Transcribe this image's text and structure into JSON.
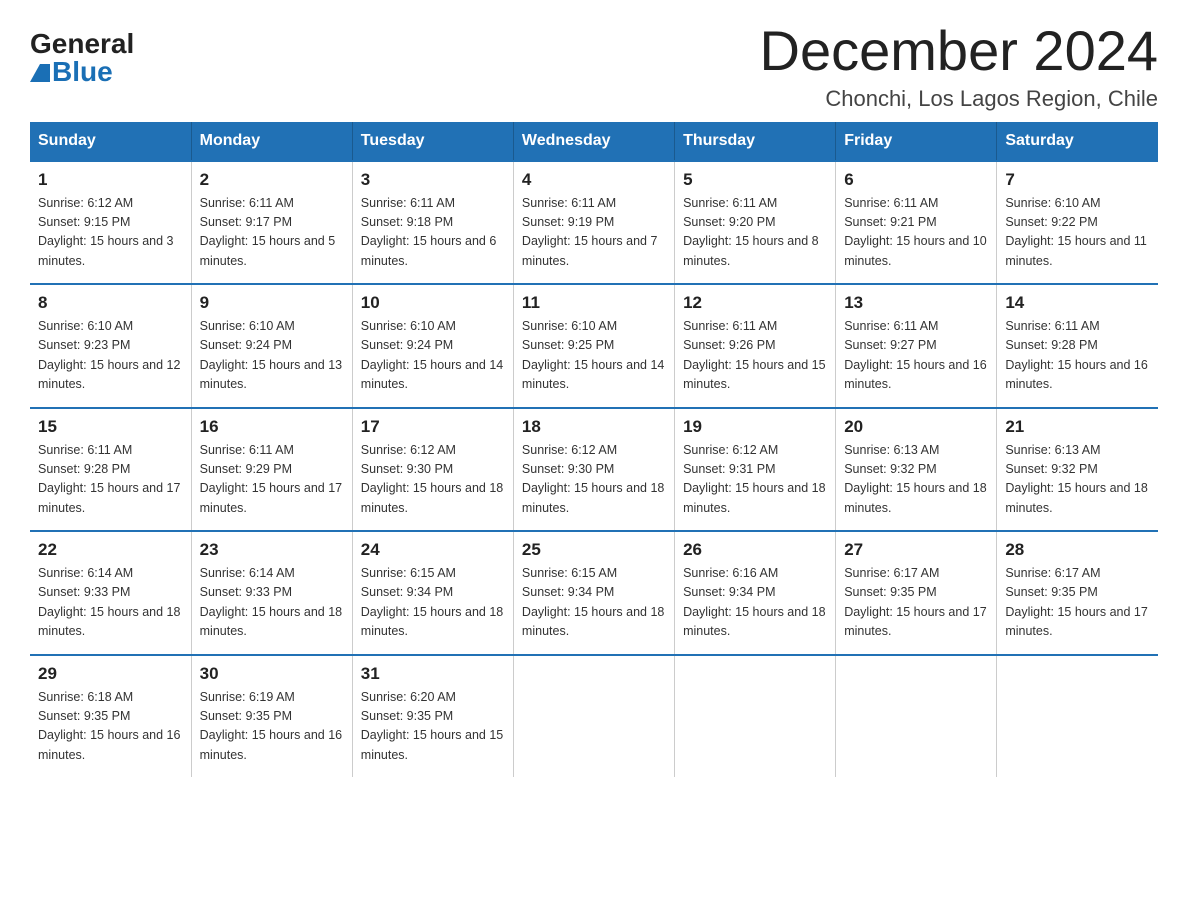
{
  "logo": {
    "general": "General",
    "blue": "Blue"
  },
  "title": "December 2024",
  "subtitle": "Chonchi, Los Lagos Region, Chile",
  "headers": [
    "Sunday",
    "Monday",
    "Tuesday",
    "Wednesday",
    "Thursday",
    "Friday",
    "Saturday"
  ],
  "weeks": [
    [
      {
        "day": "1",
        "sunrise": "Sunrise: 6:12 AM",
        "sunset": "Sunset: 9:15 PM",
        "daylight": "Daylight: 15 hours and 3 minutes."
      },
      {
        "day": "2",
        "sunrise": "Sunrise: 6:11 AM",
        "sunset": "Sunset: 9:17 PM",
        "daylight": "Daylight: 15 hours and 5 minutes."
      },
      {
        "day": "3",
        "sunrise": "Sunrise: 6:11 AM",
        "sunset": "Sunset: 9:18 PM",
        "daylight": "Daylight: 15 hours and 6 minutes."
      },
      {
        "day": "4",
        "sunrise": "Sunrise: 6:11 AM",
        "sunset": "Sunset: 9:19 PM",
        "daylight": "Daylight: 15 hours and 7 minutes."
      },
      {
        "day": "5",
        "sunrise": "Sunrise: 6:11 AM",
        "sunset": "Sunset: 9:20 PM",
        "daylight": "Daylight: 15 hours and 8 minutes."
      },
      {
        "day": "6",
        "sunrise": "Sunrise: 6:11 AM",
        "sunset": "Sunset: 9:21 PM",
        "daylight": "Daylight: 15 hours and 10 minutes."
      },
      {
        "day": "7",
        "sunrise": "Sunrise: 6:10 AM",
        "sunset": "Sunset: 9:22 PM",
        "daylight": "Daylight: 15 hours and 11 minutes."
      }
    ],
    [
      {
        "day": "8",
        "sunrise": "Sunrise: 6:10 AM",
        "sunset": "Sunset: 9:23 PM",
        "daylight": "Daylight: 15 hours and 12 minutes."
      },
      {
        "day": "9",
        "sunrise": "Sunrise: 6:10 AM",
        "sunset": "Sunset: 9:24 PM",
        "daylight": "Daylight: 15 hours and 13 minutes."
      },
      {
        "day": "10",
        "sunrise": "Sunrise: 6:10 AM",
        "sunset": "Sunset: 9:24 PM",
        "daylight": "Daylight: 15 hours and 14 minutes."
      },
      {
        "day": "11",
        "sunrise": "Sunrise: 6:10 AM",
        "sunset": "Sunset: 9:25 PM",
        "daylight": "Daylight: 15 hours and 14 minutes."
      },
      {
        "day": "12",
        "sunrise": "Sunrise: 6:11 AM",
        "sunset": "Sunset: 9:26 PM",
        "daylight": "Daylight: 15 hours and 15 minutes."
      },
      {
        "day": "13",
        "sunrise": "Sunrise: 6:11 AM",
        "sunset": "Sunset: 9:27 PM",
        "daylight": "Daylight: 15 hours and 16 minutes."
      },
      {
        "day": "14",
        "sunrise": "Sunrise: 6:11 AM",
        "sunset": "Sunset: 9:28 PM",
        "daylight": "Daylight: 15 hours and 16 minutes."
      }
    ],
    [
      {
        "day": "15",
        "sunrise": "Sunrise: 6:11 AM",
        "sunset": "Sunset: 9:28 PM",
        "daylight": "Daylight: 15 hours and 17 minutes."
      },
      {
        "day": "16",
        "sunrise": "Sunrise: 6:11 AM",
        "sunset": "Sunset: 9:29 PM",
        "daylight": "Daylight: 15 hours and 17 minutes."
      },
      {
        "day": "17",
        "sunrise": "Sunrise: 6:12 AM",
        "sunset": "Sunset: 9:30 PM",
        "daylight": "Daylight: 15 hours and 18 minutes."
      },
      {
        "day": "18",
        "sunrise": "Sunrise: 6:12 AM",
        "sunset": "Sunset: 9:30 PM",
        "daylight": "Daylight: 15 hours and 18 minutes."
      },
      {
        "day": "19",
        "sunrise": "Sunrise: 6:12 AM",
        "sunset": "Sunset: 9:31 PM",
        "daylight": "Daylight: 15 hours and 18 minutes."
      },
      {
        "day": "20",
        "sunrise": "Sunrise: 6:13 AM",
        "sunset": "Sunset: 9:32 PM",
        "daylight": "Daylight: 15 hours and 18 minutes."
      },
      {
        "day": "21",
        "sunrise": "Sunrise: 6:13 AM",
        "sunset": "Sunset: 9:32 PM",
        "daylight": "Daylight: 15 hours and 18 minutes."
      }
    ],
    [
      {
        "day": "22",
        "sunrise": "Sunrise: 6:14 AM",
        "sunset": "Sunset: 9:33 PM",
        "daylight": "Daylight: 15 hours and 18 minutes."
      },
      {
        "day": "23",
        "sunrise": "Sunrise: 6:14 AM",
        "sunset": "Sunset: 9:33 PM",
        "daylight": "Daylight: 15 hours and 18 minutes."
      },
      {
        "day": "24",
        "sunrise": "Sunrise: 6:15 AM",
        "sunset": "Sunset: 9:34 PM",
        "daylight": "Daylight: 15 hours and 18 minutes."
      },
      {
        "day": "25",
        "sunrise": "Sunrise: 6:15 AM",
        "sunset": "Sunset: 9:34 PM",
        "daylight": "Daylight: 15 hours and 18 minutes."
      },
      {
        "day": "26",
        "sunrise": "Sunrise: 6:16 AM",
        "sunset": "Sunset: 9:34 PM",
        "daylight": "Daylight: 15 hours and 18 minutes."
      },
      {
        "day": "27",
        "sunrise": "Sunrise: 6:17 AM",
        "sunset": "Sunset: 9:35 PM",
        "daylight": "Daylight: 15 hours and 17 minutes."
      },
      {
        "day": "28",
        "sunrise": "Sunrise: 6:17 AM",
        "sunset": "Sunset: 9:35 PM",
        "daylight": "Daylight: 15 hours and 17 minutes."
      }
    ],
    [
      {
        "day": "29",
        "sunrise": "Sunrise: 6:18 AM",
        "sunset": "Sunset: 9:35 PM",
        "daylight": "Daylight: 15 hours and 16 minutes."
      },
      {
        "day": "30",
        "sunrise": "Sunrise: 6:19 AM",
        "sunset": "Sunset: 9:35 PM",
        "daylight": "Daylight: 15 hours and 16 minutes."
      },
      {
        "day": "31",
        "sunrise": "Sunrise: 6:20 AM",
        "sunset": "Sunset: 9:35 PM",
        "daylight": "Daylight: 15 hours and 15 minutes."
      },
      null,
      null,
      null,
      null
    ]
  ]
}
